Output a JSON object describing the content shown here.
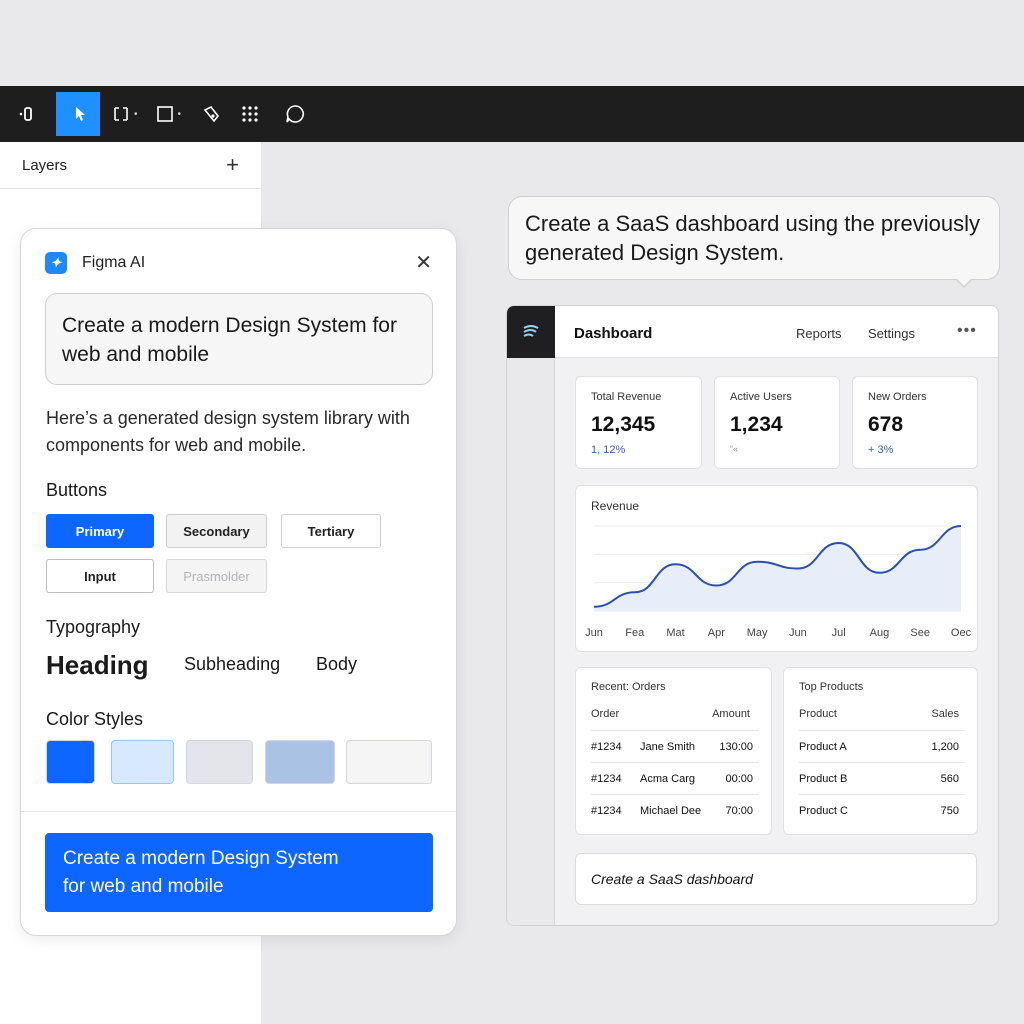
{
  "layers": {
    "title": "Layers",
    "add_label": "+"
  },
  "ai_panel": {
    "title": "Figma AI",
    "logo": "✦",
    "close": "✕",
    "prompt": "Create a modern Design System for web and mobile",
    "description": "Here’s a generated design system library with components for web and mobile.",
    "buttons_title": "Buttons",
    "buttons": {
      "primary": "Primary",
      "secondary": "Secondary",
      "tertiary": "Tertiary",
      "input": "Input",
      "placeholder": "Prasmolder"
    },
    "typography_title": "Typography",
    "typography": {
      "heading": "Heading",
      "subheading": "Subheading",
      "body": "Body"
    },
    "color_styles_title": "Color Styles",
    "colors": [
      "#0d66ff",
      "#d6e9ff",
      "#e3e5ea",
      "#aac3e4",
      "#f5f5f6"
    ],
    "cta": "Create a modern Design System for web and mobile",
    "cta_line1": "Create a modern Design System",
    "cta_line2": "for web and mobile"
  },
  "bubble": {
    "text": "Create a SaaS dashboard using the previously generated Design System."
  },
  "dashboard": {
    "title": "Dashboard",
    "nav": [
      "Reports",
      "Settings"
    ],
    "more": "•••",
    "kpis": [
      {
        "label": "Total Revenue",
        "value": "12,345",
        "delta": "1, 12%"
      },
      {
        "label": "Active Users",
        "value": "1,234",
        "delta": "“«"
      },
      {
        "label": "New Orders",
        "value": "678",
        "delta": "+ 3%"
      }
    ],
    "revenue_chart_title": "Revenue",
    "recent_orders": {
      "title": "Recent: Orders",
      "headers": [
        "Order",
        "Amount"
      ],
      "rows": [
        {
          "id": "#1234",
          "name": "Jane Smith",
          "amount": "130:00"
        },
        {
          "id": "#1234",
          "name": "Acma Carg",
          "amount": "00:00"
        },
        {
          "id": "#1234",
          "name": "Michael Dee",
          "amount": "70:00"
        }
      ]
    },
    "top_products": {
      "title": "Top Products",
      "headers": [
        "Product",
        "Sales"
      ],
      "rows": [
        {
          "product": "Product A",
          "sales": "1,200"
        },
        {
          "product": "Product B",
          "sales": "560"
        },
        {
          "product": "Product C",
          "sales": "750"
        }
      ]
    },
    "prompt_input": "Create a SaaS dashboard"
  },
  "chart_data": {
    "type": "area",
    "title": "Revenue",
    "categories": [
      "Jun",
      "Fea",
      "Mat",
      "Apr",
      "May",
      "Jun",
      "Jul",
      "Aug",
      "See",
      "Oec"
    ],
    "values": [
      5,
      22,
      55,
      30,
      58,
      50,
      80,
      45,
      72,
      100
    ],
    "ylim": [
      0,
      100
    ],
    "grid": true,
    "color": "#2a4fb0",
    "fill": "#e8eef9"
  }
}
